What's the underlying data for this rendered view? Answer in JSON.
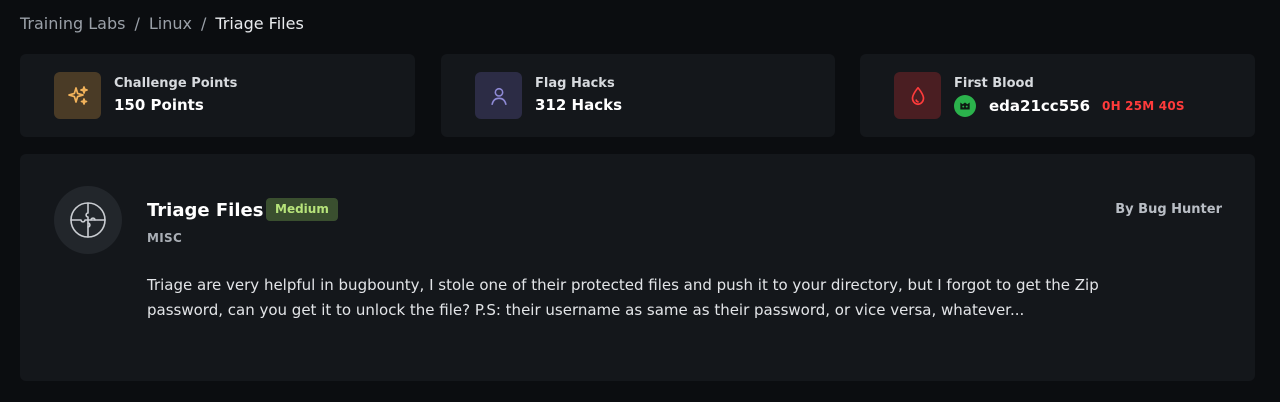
{
  "breadcrumb": {
    "items": [
      "Training Labs",
      "Linux"
    ],
    "current": "Triage Files",
    "separator": "/"
  },
  "stats": {
    "points": {
      "label": "Challenge Points",
      "value": "150 Points",
      "icon": "sparkles-icon",
      "color": "#f2b35b"
    },
    "hacks": {
      "label": "Flag Hacks",
      "value": "312 Hacks",
      "icon": "user-icon",
      "color": "#8f8ad6"
    },
    "first_blood": {
      "label": "First Blood",
      "user": "eda21cc556",
      "time": "0H 25M 40S",
      "icon": "blood-drop-icon",
      "color": "#ff3b3b"
    }
  },
  "challenge": {
    "title": "Triage Files",
    "difficulty": "Medium",
    "category": "MISC",
    "author": "By Bug Hunter",
    "icon": "puzzle-icon",
    "description": "Triage are very helpful in bugbounty, I stole one of their protected files and push it to your directory, but I forgot to get the Zip password, can you get it to unlock the file? P.S: their username as same as their password, or vice versa, whatever..."
  }
}
